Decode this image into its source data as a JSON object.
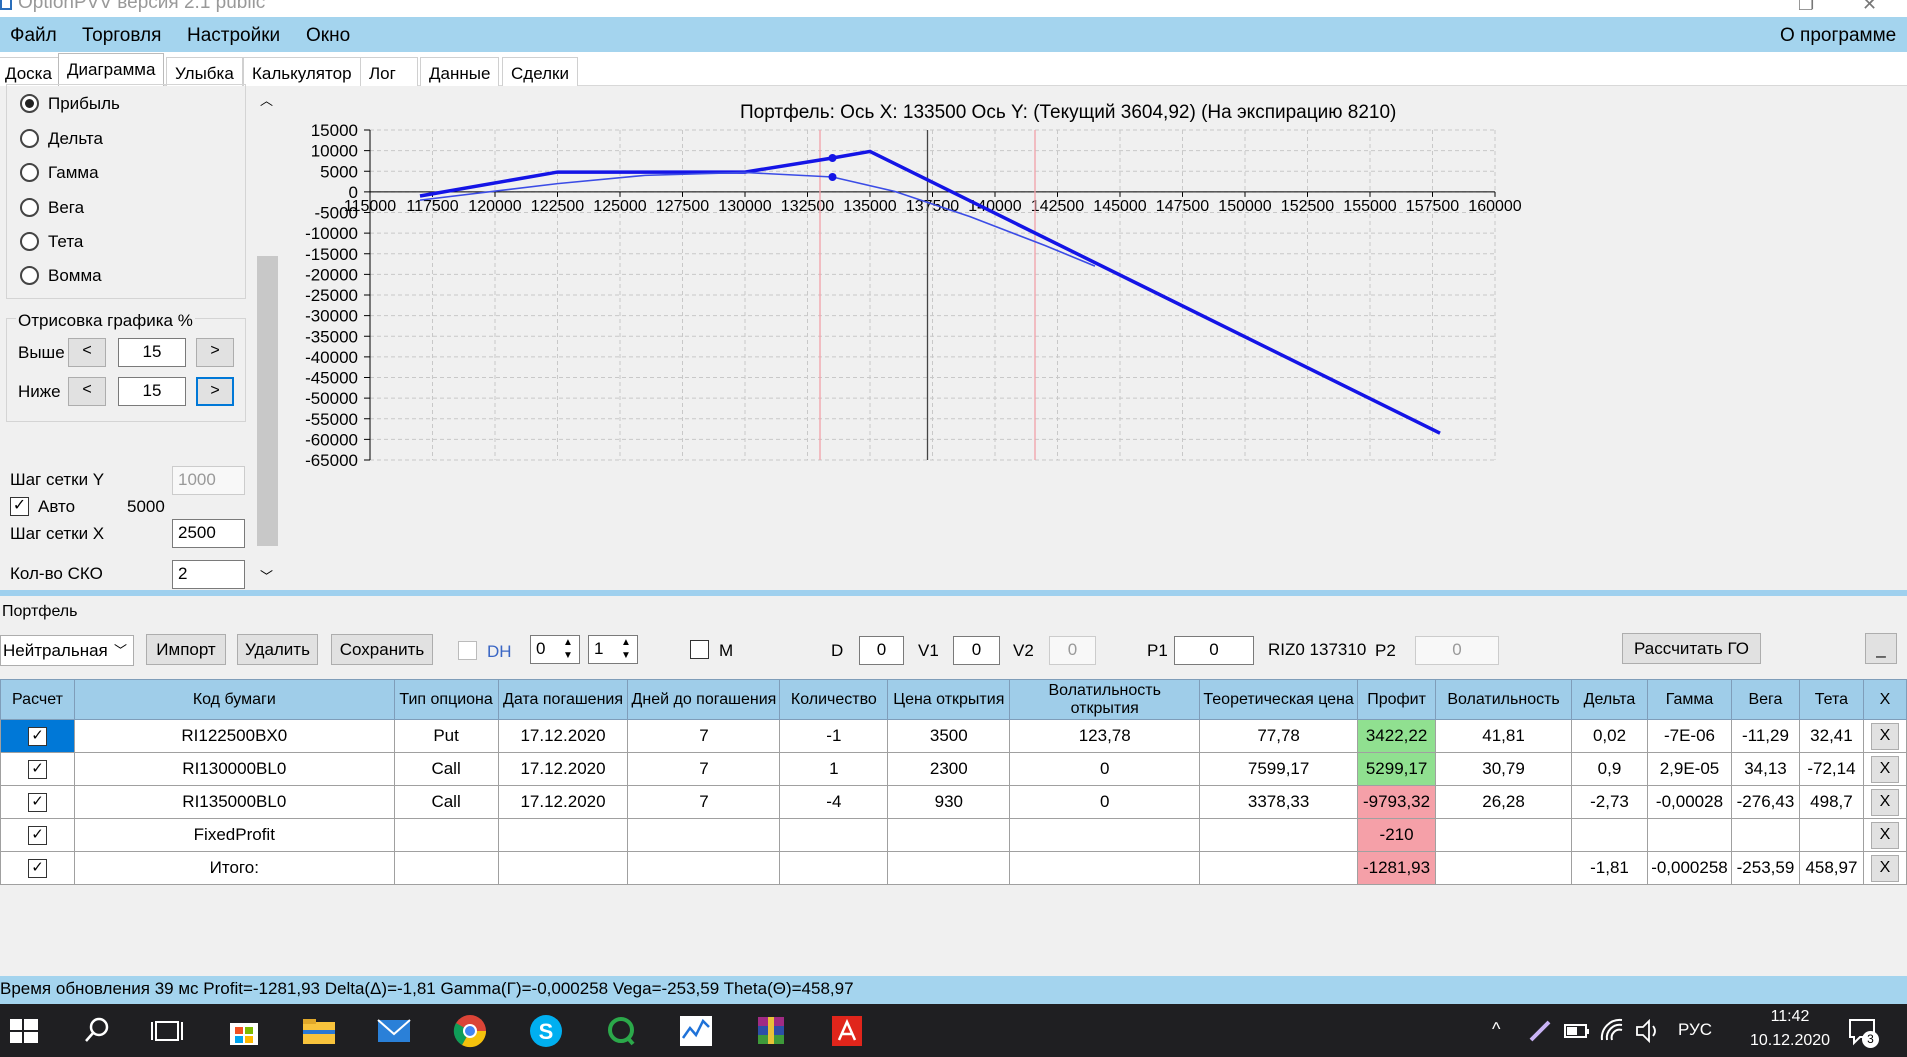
{
  "window": {
    "title": "OptionPVV версия 2.1 public"
  },
  "menu": {
    "items": [
      "Файл",
      "Торговля",
      "Настройки",
      "Окно"
    ],
    "about": "О программе"
  },
  "tabs": [
    {
      "label": "Доска",
      "active": false
    },
    {
      "label": "Диаграмма",
      "active": true
    },
    {
      "label": "Улыбка",
      "active": false
    },
    {
      "label": "Калькулятор",
      "active": false
    },
    {
      "label": "Лог",
      "active": false
    },
    {
      "label": "Данные",
      "active": false
    },
    {
      "label": "Сделки",
      "active": false
    }
  ],
  "left": {
    "radios": [
      {
        "label": "Прибыль",
        "checked": true
      },
      {
        "label": "Дельта",
        "checked": false
      },
      {
        "label": "Гамма",
        "checked": false
      },
      {
        "label": "Вега",
        "checked": false
      },
      {
        "label": "Тета",
        "checked": false
      },
      {
        "label": "Вомма",
        "checked": false
      }
    ],
    "draw_group": "Отрисовка графика %",
    "above_label": "Выше",
    "above_value": "15",
    "below_label": "Ниже",
    "below_value": "15",
    "prev": "<",
    "next": ">",
    "grid_y_label": "Шаг сетки Y",
    "grid_y_value": "1000",
    "auto_label": "Авто",
    "auto_checked": true,
    "auto_value": "5000",
    "grid_x_label": "Шаг сетки X",
    "grid_x_value": "2500",
    "sko_label": "Кол-во СКО",
    "sko_value": "2"
  },
  "chart_data": {
    "type": "line",
    "title": "Портфель:  Ось X:  133500  Ось Y:   (Текущий 3604,92)   (На экспирацию 8210)",
    "xlim": [
      115000,
      160000
    ],
    "ylim": [
      -65000,
      15000
    ],
    "x_ticks": [
      "115000",
      "117500",
      "120000",
      "122500",
      "125000",
      "127500",
      "130000",
      "132500",
      "135000",
      "137500",
      "140000",
      "142500",
      "145000",
      "147500",
      "150000",
      "152500",
      "155000",
      "157500",
      "160000"
    ],
    "y_ticks": [
      "15000",
      "10000",
      "5000",
      "0",
      "-5000",
      "-10000",
      "-15000",
      "-20000",
      "-25000",
      "-30000",
      "-35000",
      "-40000",
      "-45000",
      "-50000",
      "-55000",
      "-60000",
      "-65000"
    ],
    "series": [
      {
        "points": [
          [
            117000,
            -1000
          ],
          [
            122500,
            4800
          ],
          [
            130000,
            4800
          ],
          [
            133500,
            8210
          ],
          [
            135000,
            9800
          ],
          [
            157800,
            -58500
          ]
        ],
        "color": "#1414e6",
        "width": 3.5
      },
      {
        "points": [
          [
            117000,
            -2000
          ],
          [
            122500,
            2000
          ],
          [
            126000,
            4000
          ],
          [
            130000,
            4700
          ],
          [
            133500,
            3604.92
          ],
          [
            136000,
            100
          ],
          [
            139000,
            -6000
          ],
          [
            142000,
            -13000
          ],
          [
            144000,
            -18000
          ]
        ],
        "color": "#3b4ce6",
        "width": 1.6
      }
    ],
    "markers": [
      [
        133500,
        8210
      ],
      [
        133500,
        3604.92
      ]
    ],
    "cursor_x": 137300,
    "sko_lines": [
      133000,
      141600
    ]
  },
  "portfolio": {
    "label": "Портфель",
    "strategy": "Нейтральная",
    "import": "Импорт",
    "delete": "Удалить",
    "save": "Сохранить",
    "dh_label": "DH",
    "spin1": "0",
    "spin2": "1",
    "m_label": "M",
    "d_label": "D",
    "d_value": "0",
    "v1_label": "V1",
    "v1_value": "0",
    "v2_label": "V2",
    "v2_value": "0",
    "p1_label": "P1",
    "p1_value": "0",
    "riz_label": "RIZ0 137310",
    "p2_label": "P2",
    "p2_value": "0",
    "calc_go": "Рассчитать ГО",
    "minimize": "_"
  },
  "grid": {
    "columns": [
      "Расчет",
      "Код бумаги",
      "Тип опциона",
      "Дата погашения",
      "Дней до погашения",
      "Количество",
      "Цена открытия",
      "Волатильность открытия",
      "Теоретическая цена",
      "Профит",
      "Волатильность",
      "Дельта",
      "Гамма",
      "Вега",
      "Тета",
      "X"
    ],
    "rows": [
      {
        "code": "RI122500BX0",
        "type": "Put",
        "date": "17.12.2020",
        "days": "7",
        "qty": "-1",
        "open": "3500",
        "vol_open": "123,78",
        "theo": "77,78",
        "profit": "3422,22",
        "vol": "41,81",
        "delta": "0,02",
        "gamma": "-7E-06",
        "vega": "-11,29",
        "theta": "32,41",
        "profit_color": "green",
        "selected": true
      },
      {
        "code": "RI130000BL0",
        "type": "Call",
        "date": "17.12.2020",
        "days": "7",
        "qty": "1",
        "open": "2300",
        "vol_open": "0",
        "theo": "7599,17",
        "profit": "5299,17",
        "vol": "30,79",
        "delta": "0,9",
        "gamma": "2,9E-05",
        "vega": "34,13",
        "theta": "-72,14",
        "profit_color": "green",
        "selected": false
      },
      {
        "code": "RI135000BL0",
        "type": "Call",
        "date": "17.12.2020",
        "days": "7",
        "qty": "-4",
        "open": "930",
        "vol_open": "0",
        "theo": "3378,33",
        "profit": "-9793,32",
        "vol": "26,28",
        "delta": "-2,73",
        "gamma": "-0,00028",
        "vega": "-276,43",
        "theta": "498,7",
        "profit_color": "red",
        "selected": false
      },
      {
        "code": "FixedProfit",
        "type": "",
        "date": "",
        "days": "",
        "qty": "",
        "open": "",
        "vol_open": "",
        "theo": "",
        "profit": "-210",
        "vol": "",
        "delta": "",
        "gamma": "",
        "vega": "",
        "theta": "",
        "profit_color": "red",
        "selected": false
      },
      {
        "code": "Итого:",
        "type": "",
        "date": "",
        "days": "",
        "qty": "",
        "open": "",
        "vol_open": "",
        "theo": "",
        "profit": "-1281,93",
        "vol": "",
        "delta": "-1,81",
        "gamma": "-0,000258",
        "vega": "-253,59",
        "theta": "458,97",
        "profit_color": "red",
        "selected": false
      }
    ],
    "x_label": "X"
  },
  "status": "Время обновления 39 мс  Profit=-1281,93 Delta(Δ)=-1,81 Gamma(Γ)=-0,000258 Vega=-253,59 Theta(Θ)=458,97",
  "taskbar": {
    "lang": "РУС",
    "time": "11:42",
    "date": "10.12.2020",
    "notif_count": "3",
    "caret": "^"
  },
  "colors": {
    "menubar": "#a4d4ee",
    "grid_header": "#9fcde9",
    "profit_green": "#90e090",
    "profit_red": "#f5a0a8",
    "selection": "#0078d7"
  }
}
